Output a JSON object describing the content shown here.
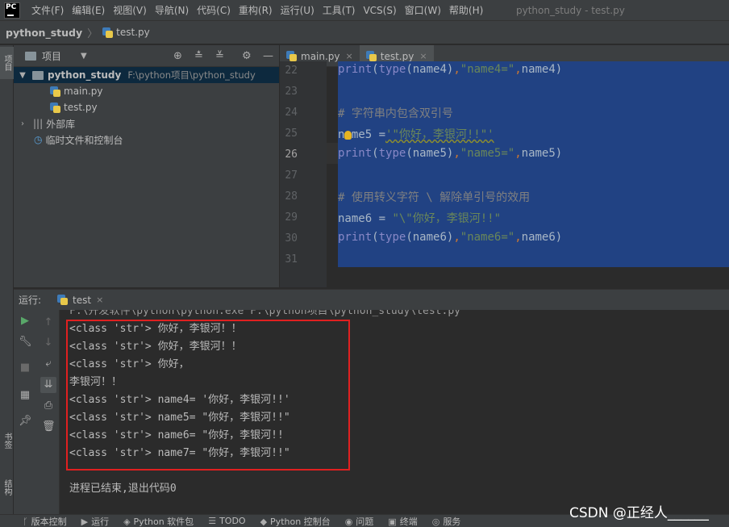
{
  "menubar": {
    "items": [
      "文件(F)",
      "编辑(E)",
      "视图(V)",
      "导航(N)",
      "代码(C)",
      "重构(R)",
      "运行(U)",
      "工具(T)",
      "VCS(S)",
      "窗口(W)",
      "帮助(H)"
    ],
    "window_title": "python_study - test.py",
    "logo_text": "PC"
  },
  "breadcrumb": {
    "project": "python_study",
    "file": "test.py"
  },
  "left_strip": {
    "project_tab": "项目",
    "bookmarks_tab": "书签",
    "structure_tab": "结构"
  },
  "project_panel": {
    "title": "项目",
    "root_name": "python_study",
    "root_path": "F:\\python项目\\python_study",
    "files": [
      "main.py",
      "test.py"
    ],
    "external_libs": "外部库",
    "scratches": "临时文件和控制台"
  },
  "editor": {
    "tabs": [
      "main.py",
      "test.py"
    ],
    "active_tab": "test.py",
    "line_numbers": [
      "22",
      "23",
      "24",
      "25",
      "26",
      "27",
      "28",
      "29",
      "30",
      "31"
    ],
    "current_line": "26",
    "code": {
      "l22_print": "print",
      "l22_type": "type",
      "l22_a": "(",
      "l22_b": "(name4)",
      "l22_c": ",",
      "l22_d": "\"name4=\"",
      "l22_e": ",",
      "l22_f": "name4)",
      "l24_comment": "# 字符串内包含双引号",
      "l25_a": "name5 =",
      "l25_b": "'\"你好，李银河!!\"'",
      "l26_print": "print",
      "l26_type": "type",
      "l26_a": "(",
      "l26_b": "(name5)",
      "l26_c": ",",
      "l26_d": "\"name5=\"",
      "l26_e": ",",
      "l26_f": "name5)",
      "l28_comment": "# 使用转义字符 \\ 解除单引号的效用",
      "l29_a": "name6 = ",
      "l29_b": "\"\\\"你好，李银河!!\"",
      "l30_print": "print",
      "l30_type": "type",
      "l30_a": "(",
      "l30_b": "(name6)",
      "l30_c": ",",
      "l30_d": "\"name6=\"",
      "l30_e": ",",
      "l30_f": "name6)"
    }
  },
  "run_panel": {
    "label": "运行:",
    "config": "test",
    "partial_top_line": "F:\\开发软件\\python\\python.exe F:\\python项目\\python_study\\test.py",
    "output": [
      "<class 'str'> 你好，李银河！！",
      "<class 'str'> 你好，李银河！！",
      "<class 'str'> 你好，",
      "李银河！！",
      "<class 'str'> name4= '你好，李银河!!'",
      "<class 'str'> name5= \"你好，李银河!!\"",
      "<class 'str'> name6= \"你好，李银河!!",
      "<class 'str'> name7= \"你好，李银河!!\""
    ],
    "exit_message": "进程已结束,退出代码0"
  },
  "bottom_bar": {
    "items": [
      "版本控制",
      "运行",
      "Python 软件包",
      "TODO",
      "Python 控制台",
      "问题",
      "终端",
      "服务"
    ]
  },
  "watermark": "CSDN @正经人______",
  "colors": {
    "selection": "#214283",
    "highlight_box": "#e02020",
    "string": "#6a8759",
    "keyword": "#8888c6",
    "comment": "#808080"
  }
}
